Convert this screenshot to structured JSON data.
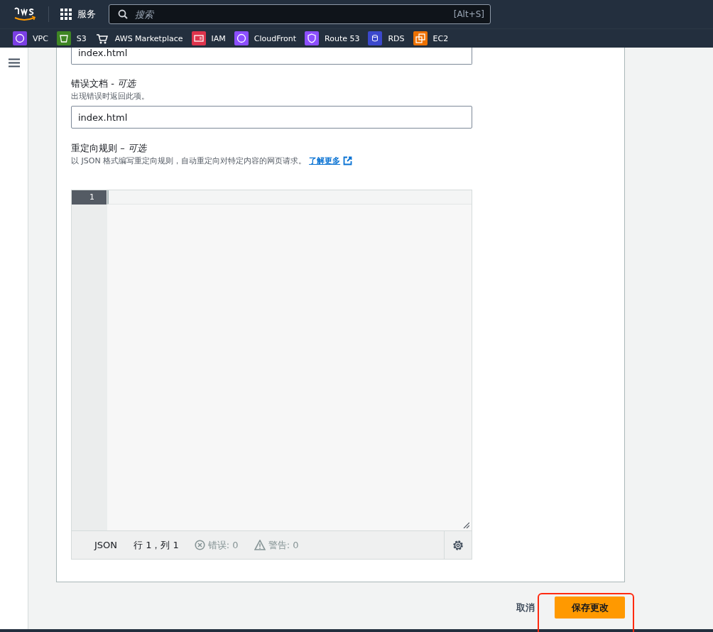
{
  "top_nav": {
    "services_label": "服务",
    "search": {
      "placeholder": "搜索",
      "shortcut": "[Alt+S]"
    }
  },
  "favorites": [
    {
      "label": "VPC",
      "color": "#7b3fe4"
    },
    {
      "label": "S3",
      "color": "#3f8624"
    },
    {
      "label": "AWS Marketplace"
    },
    {
      "label": "IAM",
      "color": "#dd344c"
    },
    {
      "label": "CloudFront",
      "color": "#8c4fff"
    },
    {
      "label": "Route 53",
      "color": "#8c4fff"
    },
    {
      "label": "RDS",
      "color": "#3b48cc"
    },
    {
      "label": "EC2",
      "color": "#ed7100"
    }
  ],
  "form": {
    "index_input": {
      "value": "index.html"
    },
    "error_document": {
      "label": "错误文档 - *可选*",
      "description": "出现错误时返回此项。",
      "value": "index.html"
    },
    "redirect_rules": {
      "label": "重定向规则 – *可选*",
      "description": "以 JSON 格式编写重定向规则，自动重定向对特定内容的网页请求。",
      "link": "了解更多",
      "editor": {
        "line_numbers": [
          "1"
        ],
        "language": "JSON",
        "position": "行 1，列 1",
        "errors": "错误: 0",
        "warnings": "警告: 0"
      }
    }
  },
  "footer": {
    "cancel": "取消",
    "save": "保存更改"
  }
}
